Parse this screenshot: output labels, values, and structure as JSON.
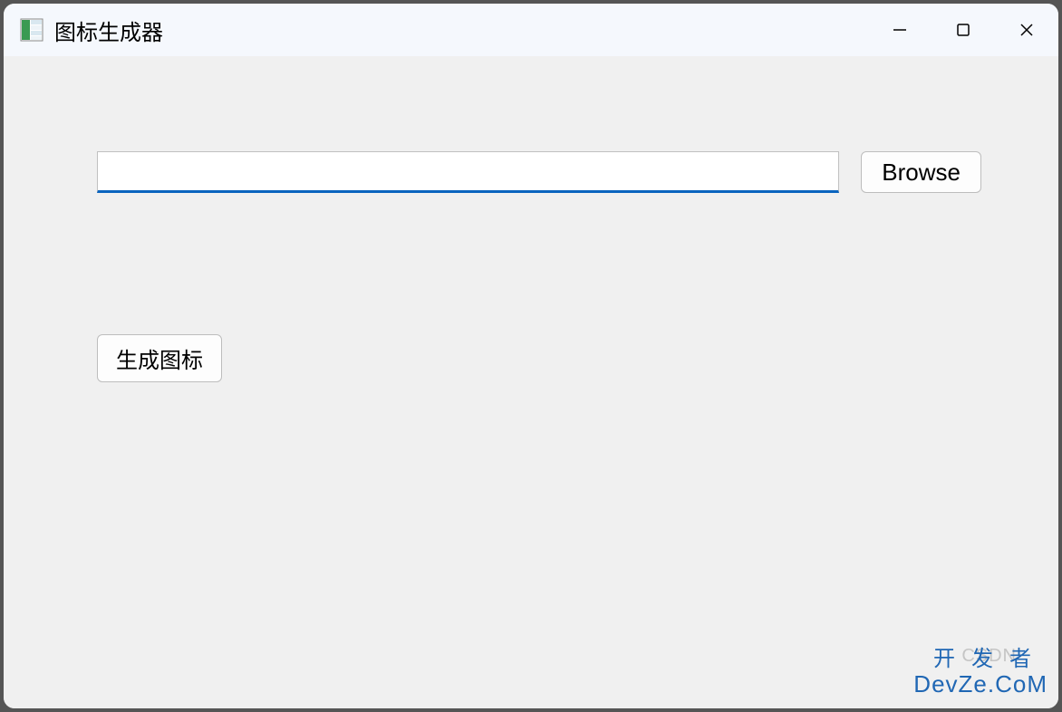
{
  "window": {
    "title": "图标生成器"
  },
  "form": {
    "path_value": "",
    "browse_label": "Browse",
    "generate_label": "生成图标"
  },
  "watermark": {
    "csdn": "CSDN",
    "devze_line1": "开发者",
    "devze_line2": "DevZe.CoM"
  }
}
